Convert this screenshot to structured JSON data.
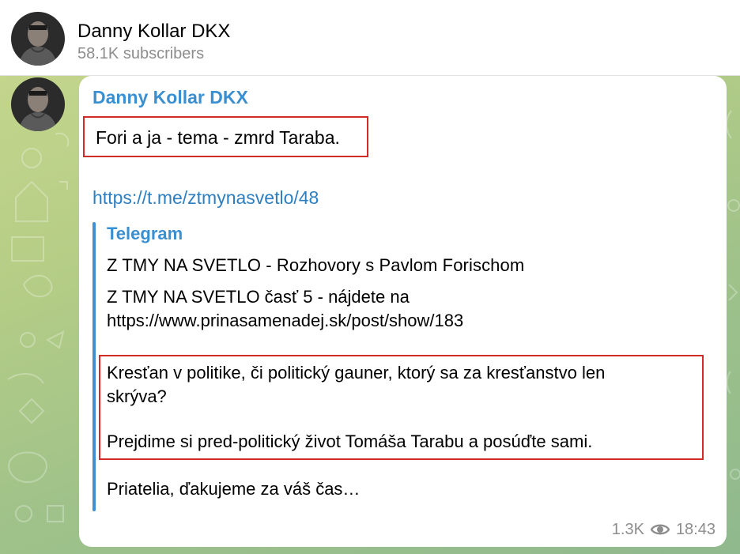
{
  "channel": {
    "name": "Danny Kollar DKX",
    "subscribers": "58.1K subscribers"
  },
  "message": {
    "sender": "Danny Kollar DKX",
    "intro": "Fori a ja - tema - zmrd Taraba.",
    "link": "https://t.me/ztmynasvetlo/48",
    "preview": {
      "site": "Telegram",
      "title": "Z TMY NA SVETLO - Rozhovory s Pavlom Forischom",
      "desc_line1": "Z TMY NA SVETLO časť 5 - nájdete na",
      "desc_line2": "https://www.prinasamenadej.sk/post/show/183",
      "quote_line1": "Kresťan v politike, či politický gauner, ktorý sa za kresťanstvo len",
      "quote_line2": "skrýva?",
      "quote_line3": "Prejdime si pred-politický život Tomáša Tarabu a posúďte sami.",
      "closing": "Priatelia, ďakujeme za váš čas…"
    },
    "views": "1.3K",
    "time": "18:43"
  },
  "icons": {
    "views": "eye-icon",
    "avatar": "avatar"
  },
  "colors": {
    "accent": "#3a8fd0",
    "link": "#2e7fc0",
    "highlight_border": "#d42a2a",
    "meta_text": "#8d8d8d"
  }
}
